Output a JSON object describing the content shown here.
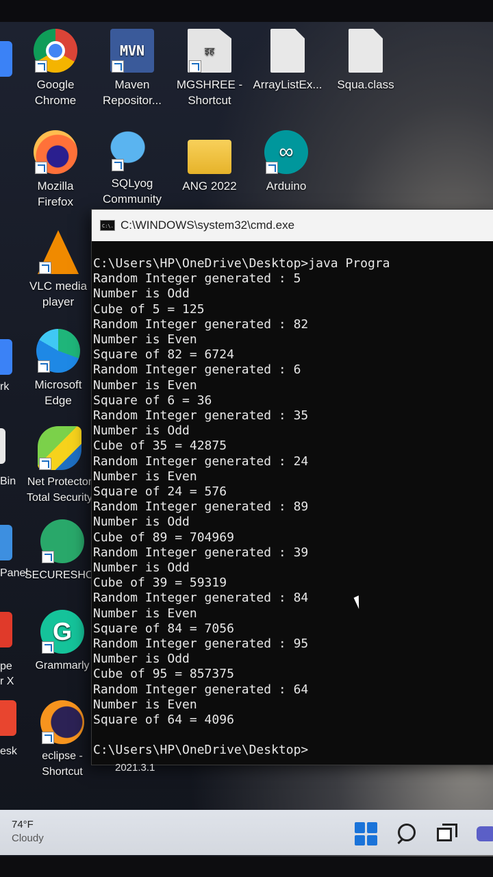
{
  "desktop": {
    "icons": [
      {
        "label": "Google Chrome",
        "name": "chrome-icon"
      },
      {
        "label": "Maven Repositor...",
        "name": "maven-icon",
        "glyph": "MVN"
      },
      {
        "label": "MGSHREE - Shortcut",
        "name": "mgshree-icon",
        "glyph": "इह"
      },
      {
        "label": "ArrayListEx...",
        "name": "file-icon"
      },
      {
        "label": "Squa.class",
        "name": "file-icon"
      },
      {
        "label": "Mozilla Firefox",
        "name": "firefox-icon"
      },
      {
        "label": "SQLyog Community",
        "name": "sqlyog-icon"
      },
      {
        "label": "ANG 2022",
        "name": "folder-icon"
      },
      {
        "label": "Arduino",
        "name": "arduino-icon",
        "glyph": "∞"
      },
      {
        "label": "VLC media player",
        "name": "vlc-icon"
      },
      {
        "label": "Microsoft Edge",
        "name": "edge-icon"
      },
      {
        "label": "Net Protector Total Security",
        "name": "net-protector-icon"
      },
      {
        "label": "SECURESHOP",
        "name": "secureshop-icon"
      },
      {
        "label": "Grammarly",
        "name": "grammarly-icon",
        "glyph": "G"
      },
      {
        "label": "eclipse - Shortcut",
        "name": "eclipse-icon"
      }
    ],
    "partial_labels": [
      "rk",
      "Bin",
      "Panel",
      "pe",
      "r X",
      "esk"
    ],
    "eclipse_version": "2021.3.1"
  },
  "cmd": {
    "title": "C:\\WINDOWS\\system32\\cmd.exe",
    "icon_text": "C:\\.",
    "lines": [
      "C:\\Users\\HP\\OneDrive\\Desktop>java Progra",
      "Random Integer generated : 5",
      "Number is Odd",
      "Cube of 5 = 125",
      "Random Integer generated : 82",
      "Number is Even",
      "Square of 82 = 6724",
      "Random Integer generated : 6",
      "Number is Even",
      "Square of 6 = 36",
      "Random Integer generated : 35",
      "Number is Odd",
      "Cube of 35 = 42875",
      "Random Integer generated : 24",
      "Number is Even",
      "Square of 24 = 576",
      "Random Integer generated : 89",
      "Number is Odd",
      "Cube of 89 = 704969",
      "Random Integer generated : 39",
      "Number is Odd",
      "Cube of 39 = 59319",
      "Random Integer generated : 84",
      "Number is Even",
      "Square of 84 = 7056",
      "Random Integer generated : 95",
      "Number is Odd",
      "Cube of 95 = 857375",
      "Random Integer generated : 64",
      "Number is Even",
      "Square of 64 = 4096"
    ],
    "prompt": "C:\\Users\\HP\\OneDrive\\Desktop>"
  },
  "taskbar": {
    "temperature": "74°F",
    "condition": "Cloudy"
  }
}
